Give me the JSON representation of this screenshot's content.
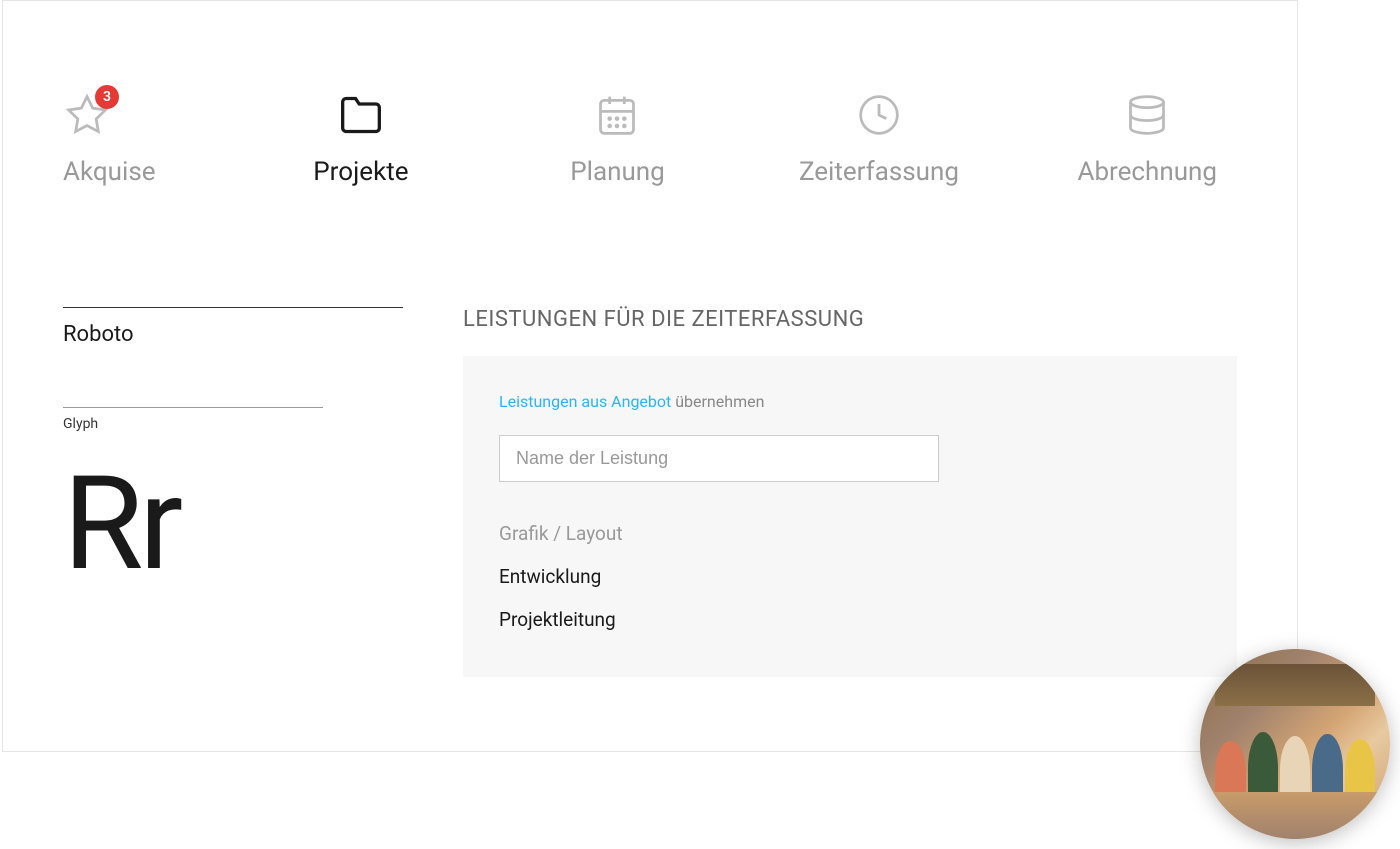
{
  "nav": {
    "items": [
      {
        "label": "Akquise",
        "icon": "star",
        "badge": "3",
        "active": false
      },
      {
        "label": "Projekte",
        "icon": "folder",
        "active": true
      },
      {
        "label": "Planung",
        "icon": "calendar",
        "active": false
      },
      {
        "label": "Zeiterfassung",
        "icon": "clock",
        "active": false
      },
      {
        "label": "Abrechnung",
        "icon": "database",
        "active": false
      }
    ]
  },
  "left": {
    "font_name": "Roboto",
    "glyph_label": "Glyph",
    "glyph_display": "Rr"
  },
  "right": {
    "section_title": "LEISTUNGEN FÜR DIE ZEITERFASSUNG",
    "link_action": "Leistungen aus Angebot",
    "link_suffix": " übernehmen",
    "input_placeholder": "Name der Leistung",
    "services": [
      {
        "label": "Grafik / Layout",
        "muted": true
      },
      {
        "label": "Entwicklung",
        "muted": false
      },
      {
        "label": "Projektleitung",
        "muted": false
      }
    ]
  }
}
